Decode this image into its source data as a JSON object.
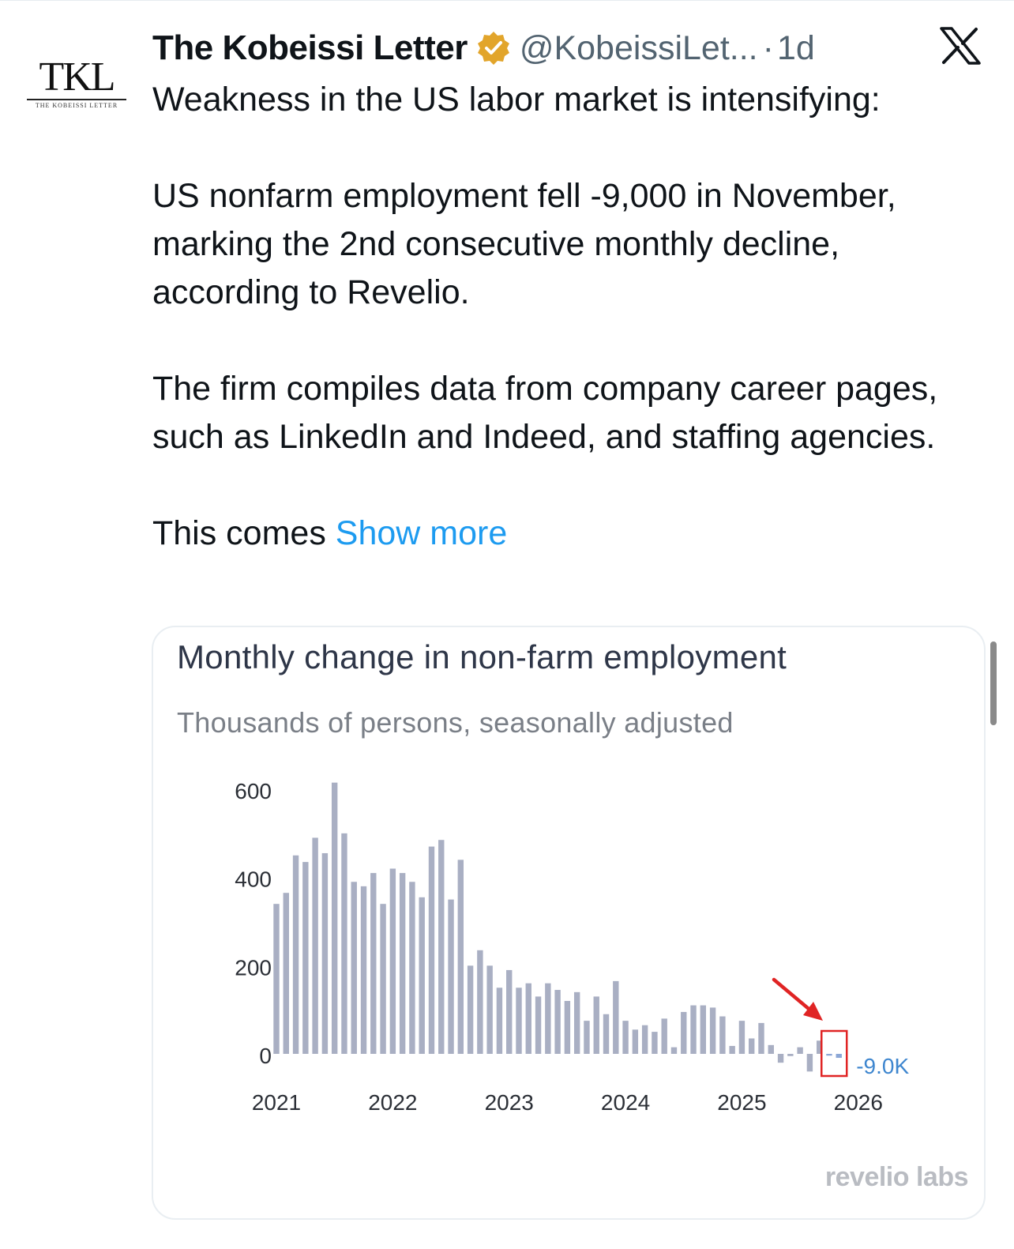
{
  "tweet": {
    "display_name": "The Kobeissi Letter",
    "handle": "@KobeissiLet...",
    "separator": "·",
    "time": "1d",
    "avatar_text": "TKL",
    "avatar_subtext": "THE KOBEISSI LETTER",
    "paragraphs": [
      "Weakness in the US labor market is intensifying:",
      "US nonfarm employment fell -9,000 in November, marking the 2nd consecutive monthly decline, according to Revelio.",
      "The firm compiles data from company career pages, such as LinkedIn and Indeed, and staffing agencies."
    ],
    "truncated_text": "This comes",
    "show_more": "Show more",
    "icons": [
      "verified-badge-icon",
      "x-logo-icon"
    ],
    "colors": {
      "link": "#1d9bf0",
      "verified": "#e2a52b",
      "muted": "#536471"
    }
  },
  "card": {
    "logo_text": "revelio labs"
  },
  "chart_data": {
    "type": "bar",
    "title": "Monthly change in non-farm employment",
    "subtitle": "Thousands of persons, seasonally adjusted",
    "xlabel": "",
    "ylabel": "",
    "x_tick_labels": [
      "2021",
      "2022",
      "2023",
      "2024",
      "2025",
      "2026"
    ],
    "y_tick_labels": [
      "600",
      "400",
      "200",
      "0"
    ],
    "ylim": [
      -40,
      620
    ],
    "grid": false,
    "x_start": "2021-01",
    "periods": [
      "2021-01",
      "2021-02",
      "2021-03",
      "2021-04",
      "2021-05",
      "2021-06",
      "2021-07",
      "2021-08",
      "2021-09",
      "2021-10",
      "2021-11",
      "2021-12",
      "2022-01",
      "2022-02",
      "2022-03",
      "2022-04",
      "2022-05",
      "2022-06",
      "2022-07",
      "2022-08",
      "2022-09",
      "2022-10",
      "2022-11",
      "2022-12",
      "2023-01",
      "2023-02",
      "2023-03",
      "2023-04",
      "2023-05",
      "2023-06",
      "2023-07",
      "2023-08",
      "2023-09",
      "2023-10",
      "2023-11",
      "2023-12",
      "2024-01",
      "2024-02",
      "2024-03",
      "2024-04",
      "2024-05",
      "2024-06",
      "2024-07",
      "2024-08",
      "2024-09",
      "2024-10",
      "2024-11",
      "2024-12",
      "2025-01",
      "2025-02",
      "2025-03",
      "2025-04",
      "2025-05",
      "2025-06",
      "2025-07",
      "2025-08",
      "2025-09",
      "2025-10",
      "2025-11"
    ],
    "values": [
      340,
      365,
      450,
      435,
      490,
      455,
      615,
      500,
      390,
      380,
      410,
      340,
      420,
      410,
      390,
      355,
      470,
      485,
      350,
      440,
      200,
      235,
      200,
      150,
      190,
      150,
      160,
      130,
      160,
      145,
      120,
      140,
      75,
      130,
      90,
      165,
      75,
      55,
      65,
      50,
      80,
      15,
      95,
      110,
      110,
      105,
      85,
      18,
      75,
      35,
      70,
      20,
      -20,
      -5,
      15,
      -40,
      30,
      -4,
      -9
    ],
    "colors": {
      "bar": "#a9afc3",
      "recent": "#8ca7d6",
      "annotation": "#e02424",
      "label": "#3e86cf"
    },
    "annotation": {
      "target_period": "2025-11",
      "label": "-9.0K"
    }
  }
}
